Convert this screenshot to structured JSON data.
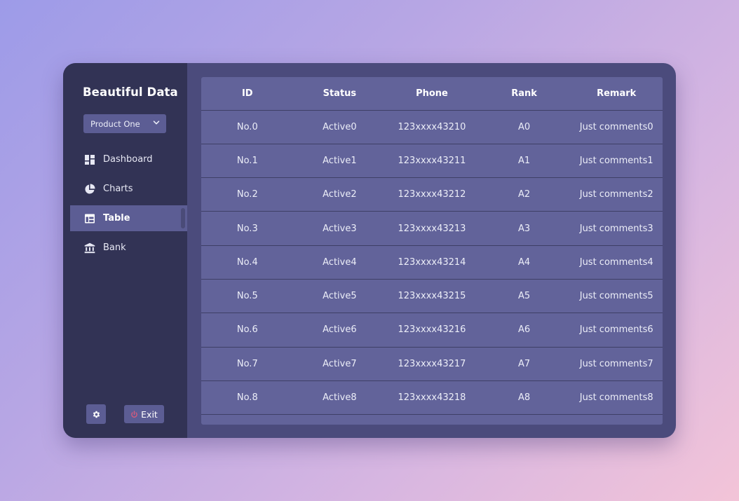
{
  "app": {
    "title": "Beautiful Data"
  },
  "product_select": {
    "value": "Product One"
  },
  "nav": {
    "items": [
      {
        "label": "Dashboard",
        "icon": "dashboard-icon"
      },
      {
        "label": "Charts",
        "icon": "pie-chart-icon"
      },
      {
        "label": "Table",
        "icon": "table-icon",
        "active": true
      },
      {
        "label": "Bank",
        "icon": "bank-icon"
      }
    ]
  },
  "footer": {
    "settings_icon": "gear-icon",
    "exit_label": "Exit",
    "exit_icon": "power-icon",
    "exit_icon_color": "#e05a7a"
  },
  "table": {
    "headers": [
      "ID",
      "Status",
      "Phone",
      "Rank",
      "Remark"
    ],
    "rows": [
      [
        "No.0",
        "Active0",
        "123xxxx43210",
        "A0",
        "Just comments0"
      ],
      [
        "No.1",
        "Active1",
        "123xxxx43211",
        "A1",
        "Just comments1"
      ],
      [
        "No.2",
        "Active2",
        "123xxxx43212",
        "A2",
        "Just comments2"
      ],
      [
        "No.3",
        "Active3",
        "123xxxx43213",
        "A3",
        "Just comments3"
      ],
      [
        "No.4",
        "Active4",
        "123xxxx43214",
        "A4",
        "Just comments4"
      ],
      [
        "No.5",
        "Active5",
        "123xxxx43215",
        "A5",
        "Just comments5"
      ],
      [
        "No.6",
        "Active6",
        "123xxxx43216",
        "A6",
        "Just comments6"
      ],
      [
        "No.7",
        "Active7",
        "123xxxx43217",
        "A7",
        "Just comments7"
      ],
      [
        "No.8",
        "Active8",
        "123xxxx43218",
        "A8",
        "Just comments8"
      ]
    ]
  },
  "colors": {
    "sidebar_bg": "#323355",
    "accent": "#5c5d94",
    "table_bg": "#62639a",
    "main_bg": "#4b4b7c"
  }
}
